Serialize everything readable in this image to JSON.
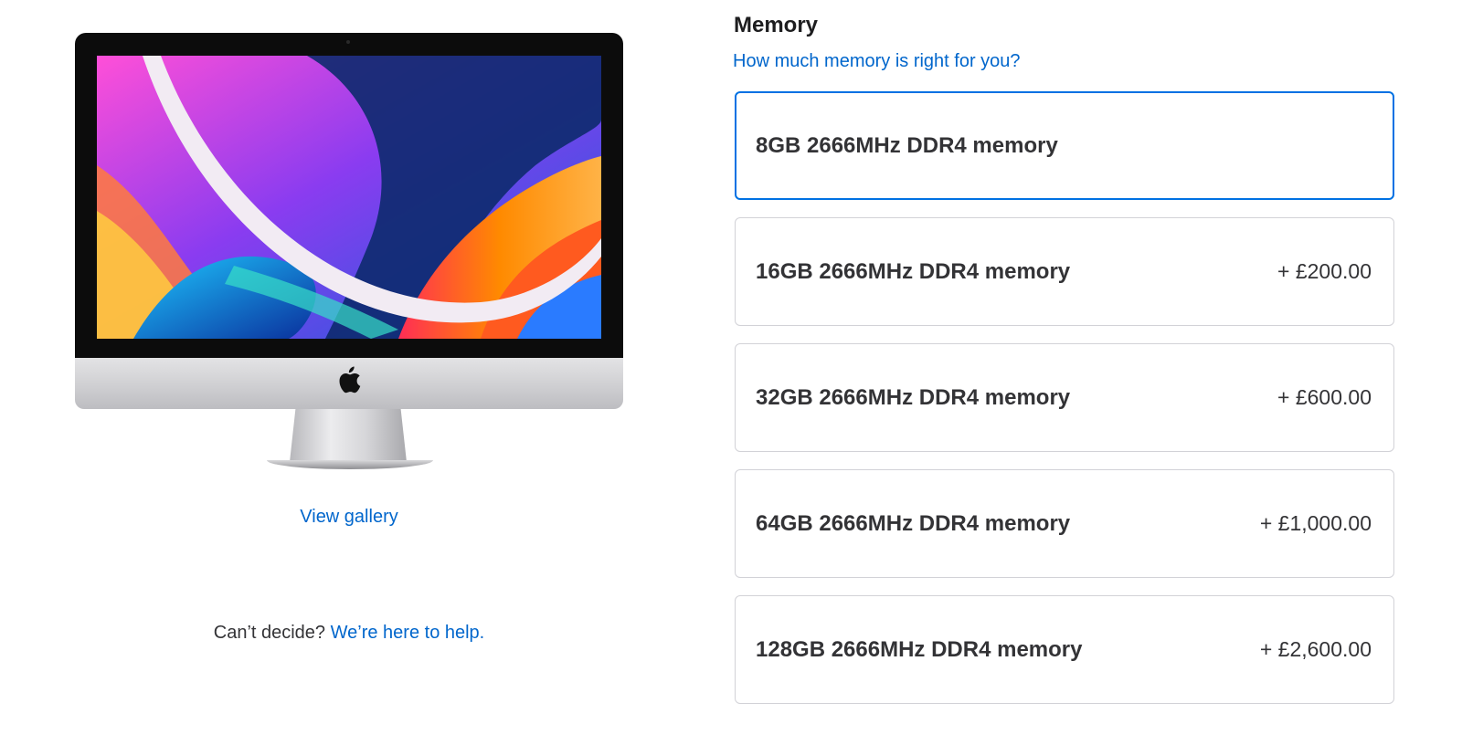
{
  "product": {
    "gallery_link": "View gallery",
    "help_prompt": "Can’t decide?",
    "help_link": "We’re here to help."
  },
  "memory": {
    "title": "Memory",
    "help_link": "How much memory is right for you?",
    "options": [
      {
        "label": "8GB 2666MHz DDR4 memory",
        "price": "",
        "selected": true
      },
      {
        "label": "16GB 2666MHz DDR4 memory",
        "price": "+ £200.00",
        "selected": false
      },
      {
        "label": "32GB 2666MHz DDR4 memory",
        "price": "+ £600.00",
        "selected": false
      },
      {
        "label": "64GB 2666MHz DDR4 memory",
        "price": "+ £1,000.00",
        "selected": false
      },
      {
        "label": "128GB 2666MHz DDR4 memory",
        "price": "+ £2,600.00",
        "selected": false
      }
    ]
  },
  "colors": {
    "accent": "#0071e3",
    "link": "#0066cc",
    "text": "#1d1d1f",
    "border": "#d2d2d7"
  }
}
